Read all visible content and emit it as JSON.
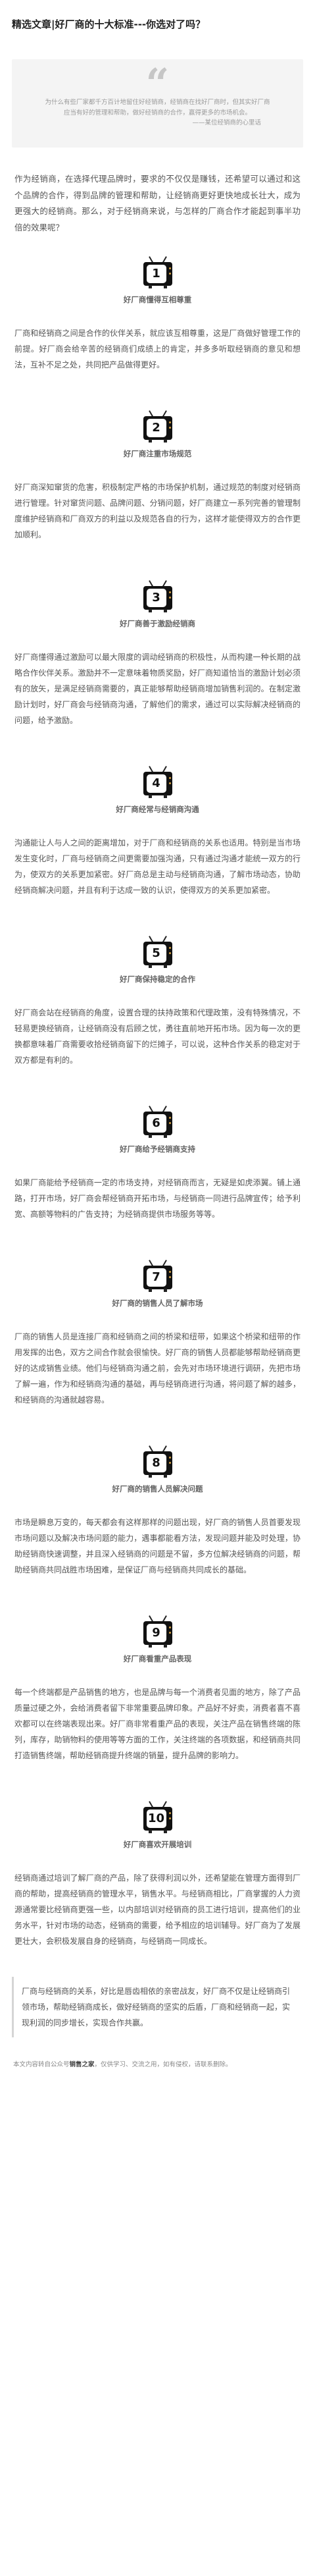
{
  "article": {
    "title": "精选文章|好厂商的十大标准---你选对了吗？",
    "quote": {
      "text": "为什么有些厂家都千方百计地留住好经销商，经销商在找好厂商时，但其实好厂商应当有好的管理和帮助，做好经销商的合作，赢得更多的市场机会。",
      "sign": "——某位经销商的心里话"
    },
    "intro": "作为经销商，在选择代理品牌时，要求的不仅仅是赚钱，还希望可以通过和这个品牌的合作，得到品牌的管理和帮助，让经销商更好更快地成长壮大，成为更强大的经销商。那么，对于经销商来说，与怎样的厂商合作才能起到事半功倍的效果呢？",
    "sections": [
      {
        "num": "1",
        "title": "好厂商懂得互相尊重",
        "body": "厂商和经销商之间是合作的伙伴关系，就应该互相尊重，这是厂商做好管理工作的前提。好厂商会给辛苦的经销商们成绩上的肯定，并多多听取经销商的意见和想法，互补不足之处，共同把产品做得更好。"
      },
      {
        "num": "2",
        "title": "好厂商注重市场规范",
        "body": "好厂商深知窜货的危害，积极制定严格的市场保护机制，通过规范的制度对经销商进行管理。针对窜货问题、品牌问题、分销问题，好厂商建立一系列完善的管理制度维护经销商和厂商双方的利益以及规范各自的行为，这样才能使得双方的合作更加顺利。"
      },
      {
        "num": "3",
        "title": "好厂商善于激励经销商",
        "body": "好厂商懂得通过激励可以最大限度的调动经销商的积极性，从而构建一种长期的战略合作伙伴关系。激励并不一定意味着物质奖励，好厂商知道恰当的激励计划必须有的放矢，是满足经销商需要的，真正能够帮助经销商增加销售利润的。在制定激励计划时，好厂商会与经销商沟通，了解他们的需求，通过可以实际解决经销商的问题，给予激励。"
      },
      {
        "num": "4",
        "title": "好厂商经常与经销商沟通",
        "body": "沟通能让人与人之间的距离增加，对于厂商和经销商的关系也适用。特别是当市场发生变化时，厂商与经销商之间更需要加强沟通，只有通过沟通才能统一双方的行为，使双方的关系更加紧密。好厂商总是主动与经销商沟通，了解市场动态，协助经销商解决问题，并且有利于达成一致的认识，使得双方的关系更加紧密。"
      },
      {
        "num": "5",
        "title": "好厂商保持稳定的合作",
        "body": "好厂商会站在经销商的角度，设置合理的扶持政策和代理政策，没有特殊情况，不轻易更换经销商，让经销商没有后顾之忧，勇往直前地开拓市场。因为每一次的更换都意味着厂商需要收拾经销商留下的烂摊子，可以说，这种合作关系的稳定对于双方都是有利的。"
      },
      {
        "num": "6",
        "title": "好厂商给予经销商支持",
        "body": "如果厂商能给予经销商一定的市场支持，对经销商而言，无疑是如虎添翼。铺上通路，打开市场，好厂商会帮经销商开拓市场，与经销商一同进行品牌宣传；给予利宽、高额等物料的广告支持；为经销商提供市场服务等等。"
      },
      {
        "num": "7",
        "title": "好厂商的销售人员了解市场",
        "body": "厂商的销售人员是连接厂商和经销商之间的桥梁和纽带，如果这个桥梁和纽带的作用发挥的出色，双方之间合作就会很愉快。好厂商的销售人员都能够帮助经销商更好的达成销售业绩。他们与经销商沟通之前，会先对市场环境进行调研，先把市场了解一遍，作为和经销商沟通的基础，再与经销商进行沟通，将问题了解的越多，和经销商的沟通就越容易。"
      },
      {
        "num": "8",
        "title": "好厂商的销售人员解决问题",
        "body": "市场是瞬息万变的，每天都会有这样那样的问题出现，好厂商的销售人员首要发现市场问题以及解决市场问题的能力，遇事都能看方法，发现问题并能及时处理，协助经销商快速调整，并且深入经销商的问题是不留，多方位解决经销商的问题，帮助经销商共同战胜市场困难，是保证厂商与经销商共同成长的基础。"
      },
      {
        "num": "9",
        "title": "好厂商看重产品表现",
        "body": "每一个终端都是产品销售的地方，也是品牌与每一个消费者见面的地方，除了产品质量过硬之外，会给消费者留下非常重要品牌印象。产品好不好卖，消费者喜不喜欢都可以在终端表现出来。好厂商非常看重产品的表现，关注产品在销售终端的陈列，库存，助销物料的使用等等方面的工作，关注终端的各项数据，和经销商共同打造销售终端，帮助经销商提升终端的销量，提升品牌的影响力。"
      },
      {
        "num": "10",
        "title": "好厂商喜欢开展培训",
        "body": "经销商通过培训了解厂商的产品，除了获得利润以外，还希望能在管理方面得到厂商的帮助，提高经销商的管理水平，销售水平。与经销商相比，厂商掌握的人力资源通常要比经销商更强一些，以内部培训对经销商的员工进行培训，提高他们的业务水平，针对市场的动态，经销商的需要，给予相应的培训辅导。好厂商为了发展更壮大，会积极发展自身的经销商，与经销商一同成长。"
      }
    ],
    "summary": "厂商与经销商的关系，好比是唇齿相依的亲密战友，好厂商不仅是让经销商引领市场，帮助经销商成长，做好经销商的坚实的后盾，厂商和经销商一起，实现利润的同步增长，实现合作共赢。",
    "footer_prefix": "本文内容转自公众号",
    "footer_source": "销售之家",
    "footer_suffix": "，仅供学习、交流之用，如有侵权，请联系删除。"
  },
  "colors": {
    "tv_body": "#111111",
    "tv_knob": "#d9a441",
    "quote_bg": "#f4f4f4"
  }
}
